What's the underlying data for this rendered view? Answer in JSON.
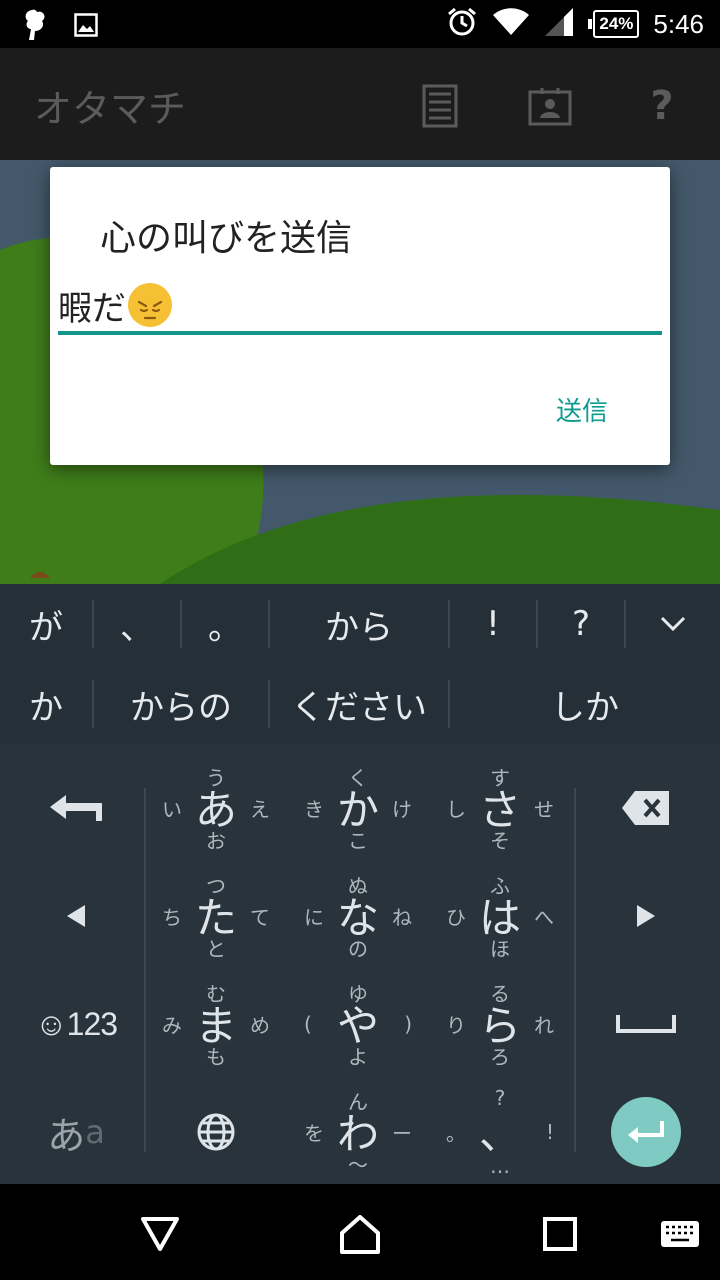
{
  "status": {
    "time": "5:46",
    "battery": "24%"
  },
  "appbar": {
    "title": "オタマチ"
  },
  "dialog": {
    "title": "心の叫びを送信",
    "input_value": "暇だ",
    "send_label": "送信"
  },
  "candidates": {
    "row1": [
      "が",
      "、",
      "。",
      "から",
      "!",
      "?"
    ],
    "row2": [
      "か",
      "からの",
      "ください",
      "しか"
    ]
  },
  "keyboard": {
    "keys": [
      {
        "main": "あ",
        "up": "う",
        "down": "お",
        "left": "い",
        "right": "え"
      },
      {
        "main": "か",
        "up": "く",
        "down": "こ",
        "left": "き",
        "right": "け"
      },
      {
        "main": "さ",
        "up": "す",
        "down": "そ",
        "left": "し",
        "right": "せ"
      },
      {
        "main": "た",
        "up": "つ",
        "down": "と",
        "left": "ち",
        "right": "て"
      },
      {
        "main": "な",
        "up": "ぬ",
        "down": "の",
        "left": "に",
        "right": "ね"
      },
      {
        "main": "は",
        "up": "ふ",
        "down": "ほ",
        "left": "ひ",
        "right": "へ"
      },
      {
        "main": "ま",
        "up": "む",
        "down": "も",
        "left": "み",
        "right": "め"
      },
      {
        "main": "や",
        "up": "ゆ",
        "down": "よ",
        "left": "(",
        "right": ")"
      },
      {
        "main": "ら",
        "up": "る",
        "down": "ろ",
        "left": "り",
        "right": "れ"
      },
      {
        "main": "わ",
        "up": "ん",
        "down": "〜",
        "left": "を",
        "right": "ー"
      },
      {
        "main": "、",
        "up": "?",
        "down": "…",
        "left": "。",
        "right": "!"
      }
    ],
    "emoji_mode": "☺123",
    "kana_mode_a": "あ",
    "kana_mode_b": "a"
  },
  "colors": {
    "accent": "#11958a",
    "keyboard_bg": "#28333b",
    "candidate_bg": "#242f37",
    "enter": "#7fcbc3"
  }
}
